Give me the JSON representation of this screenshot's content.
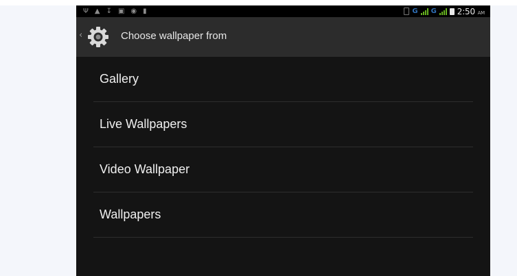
{
  "status_bar": {
    "network_label_1": "G",
    "network_label_2": "G",
    "time": "2:50",
    "am_pm": "AM"
  },
  "action_bar": {
    "title": "Choose wallpaper from",
    "icon": "gear-icon"
  },
  "wallpaper_sources": [
    {
      "label": "Gallery"
    },
    {
      "label": "Live Wallpapers"
    },
    {
      "label": "Video Wallpaper"
    },
    {
      "label": "Wallpapers"
    }
  ],
  "colors": {
    "screen_bg": "#141414",
    "action_bar_bg": "#2c2c2c",
    "divider": "#2e2e2e",
    "signal_green": "#66b31f",
    "network_blue": "#2f6fb6"
  }
}
